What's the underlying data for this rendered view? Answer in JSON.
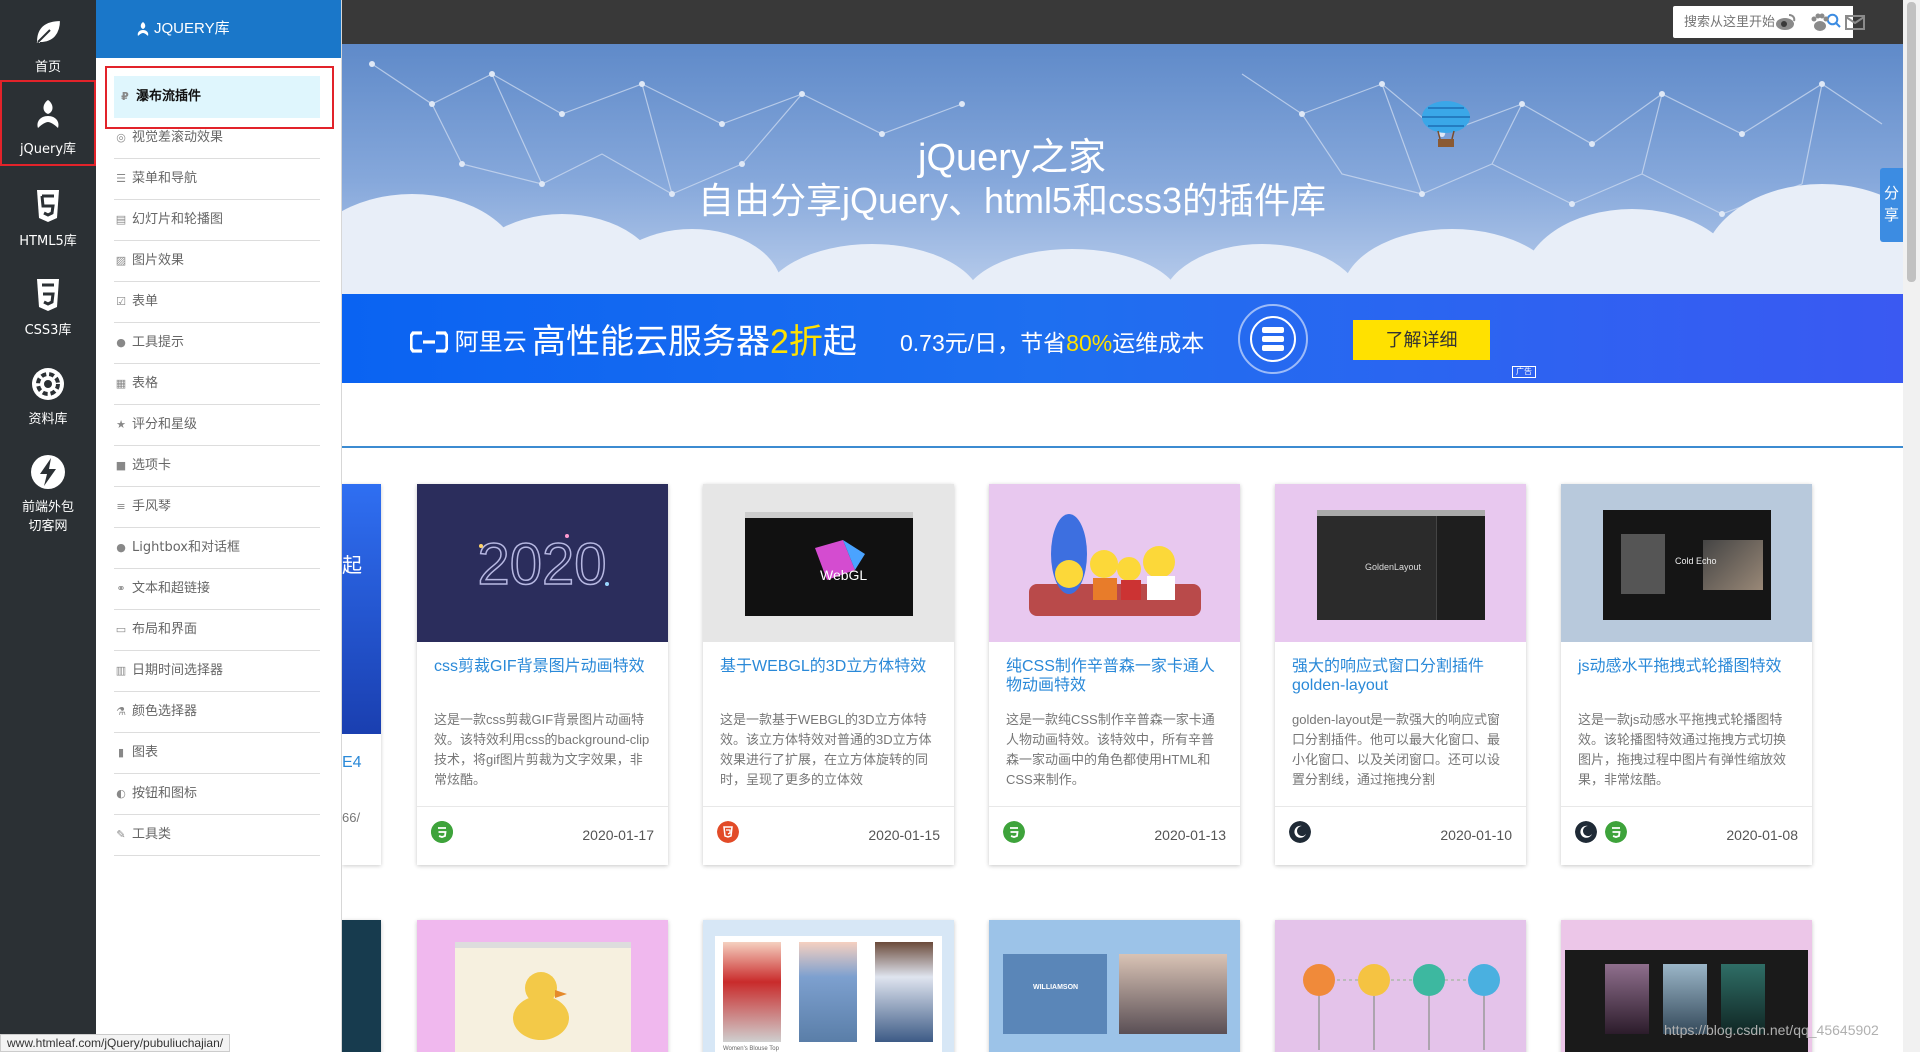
{
  "rail": {
    "items": [
      {
        "label": "首页",
        "icon": "leaf-icon"
      },
      {
        "label": "jQuery库",
        "icon": "jquery-logo-icon"
      },
      {
        "label": "HTML5库",
        "icon": "html5-icon"
      },
      {
        "label": "CSS3库",
        "icon": "css3-icon"
      },
      {
        "label": "资料库",
        "icon": "gear-icon"
      },
      {
        "label": "前端外包",
        "label2": "切客网",
        "icon": "lightning-icon"
      }
    ]
  },
  "search": {
    "placeholder": "搜索从这里开始..."
  },
  "top_icons": [
    "weibo-icon",
    "paw-icon",
    "mail-icon"
  ],
  "menu": {
    "header": "JQUERY库",
    "items": [
      {
        "label": "瀑布流插件",
        "icon": "waterfall-icon",
        "selected": true
      },
      {
        "label": "视觉差滚动效果",
        "icon": "eye-icon"
      },
      {
        "label": "菜单和导航",
        "icon": "list-icon"
      },
      {
        "label": "幻灯片和轮播图",
        "icon": "film-icon"
      },
      {
        "label": "图片效果",
        "icon": "image-icon"
      },
      {
        "label": "表单",
        "icon": "checkbox-icon"
      },
      {
        "label": "工具提示",
        "icon": "comment-icon"
      },
      {
        "label": "表格",
        "icon": "table-icon"
      },
      {
        "label": "评分和星级",
        "icon": "star-icon"
      },
      {
        "label": "选项卡",
        "icon": "folder-icon"
      },
      {
        "label": "手风琴",
        "icon": "bars-icon"
      },
      {
        "label": "Lightbox和对话框",
        "icon": "chat-icon"
      },
      {
        "label": "文本和超链接",
        "icon": "link-icon"
      },
      {
        "label": "布局和界面",
        "icon": "layout-icon"
      },
      {
        "label": "日期时间选择器",
        "icon": "calendar-icon"
      },
      {
        "label": "颜色选择器",
        "icon": "flask-icon"
      },
      {
        "label": "图表",
        "icon": "chart-icon"
      },
      {
        "label": "按钮和图标",
        "icon": "toggle-icon"
      },
      {
        "label": "工具类",
        "icon": "wrench-icon"
      }
    ]
  },
  "banner": {
    "title": "jQuery之家",
    "subtitle": "自由分享jQuery、html5和css3的插件库"
  },
  "share_tab": {
    "line1": "分",
    "line2": "享"
  },
  "ad": {
    "brand": "阿里云",
    "headline_a": "高性能云服务器",
    "headline_hl": "2折",
    "headline_b": "起",
    "price_a": "0.73元/日，节省",
    "price_hl": "80%",
    "price_b": "运维成本",
    "button": "了解详细",
    "tag": "广告"
  },
  "hidden_card": {
    "title_fragment": "起",
    "desc_fragment": "E4",
    "desc_fragment2": "66/"
  },
  "cards": [
    {
      "title": "css剪裁GIF背景图片动画特效",
      "desc": "这是一款css剪裁GIF背景图片动画特效。该特效利用css的background-clip技术，将gif图片剪裁为文字效果，非常炫酷。",
      "date": "2020-01-17",
      "badges": [
        "css3"
      ],
      "thumb_text": "2020",
      "thumb_bg": "#2b2d5c"
    },
    {
      "title": "基于WEBGL的3D立方体特效",
      "desc": "这是一款基于WEBGL的3D立方体特效。该立方体特效对普通的3D立方体效果进行了扩展，在立方体旋转的同时，呈现了更多的立体效",
      "date": "2020-01-15",
      "badges": [
        "html5"
      ],
      "thumb_text": "WebGL",
      "thumb_bg": "#e6e6e6"
    },
    {
      "title": "纯CSS制作辛普森一家卡通人物动画特效",
      "desc": "这是一款纯CSS制作辛普森一家卡通人物动画特效。该特效中，所有辛普森一家动画中的角色都使用HTML和CSS来制作。",
      "date": "2020-01-13",
      "badges": [
        "css3"
      ],
      "thumb_text": "",
      "thumb_bg": "#e8c8ef"
    },
    {
      "title": "强大的响应式窗口分割插件golden-layout",
      "desc": "golden-layout是一款强大的响应式窗口分割插件。他可以最大化窗口、最小化窗口、以及关闭窗口。还可以设置分割线，通过拖拽分割",
      "date": "2020-01-10",
      "badges": [
        "dark"
      ],
      "thumb_text": "GoldenLayout",
      "thumb_bg": "#e8c8ef"
    },
    {
      "title": "js动感水平拖拽式轮播图特效",
      "desc": "这是一款js动感水平拖拽式轮播图特效。该轮播图特效通过拖拽方式切换图片，拖拽过程中图片有弹性缩放效果，非常炫酷。",
      "date": "2020-01-08",
      "badges": [
        "dark",
        "css3"
      ],
      "thumb_text": "Cold Echo",
      "thumb_bg": "#b8c9dc"
    }
  ],
  "cards_row2": [
    {
      "thumb_bg": "#f0b8ee"
    },
    {
      "thumb_bg": "#d7e7f6",
      "thumb_text": "Women's Blouse Top"
    },
    {
      "thumb_bg": "#9cc3e8",
      "thumb_text": "WILLIAMSON"
    },
    {
      "thumb_bg": "#e4c3ea"
    },
    {
      "thumb_bg": "#ecc6e8"
    }
  ],
  "statusbar": {
    "url": "www.htmleaf.com/jQuery/pubuliuchajian/"
  },
  "watermark": "https://blog.csdn.net/qq_45645902",
  "colors": {
    "rail": "#2b3034",
    "menu_header": "#1a77c9",
    "title_link": "#2a89d8",
    "highlight_box": "#e2232a",
    "ad_yellow": "#ffe100"
  }
}
